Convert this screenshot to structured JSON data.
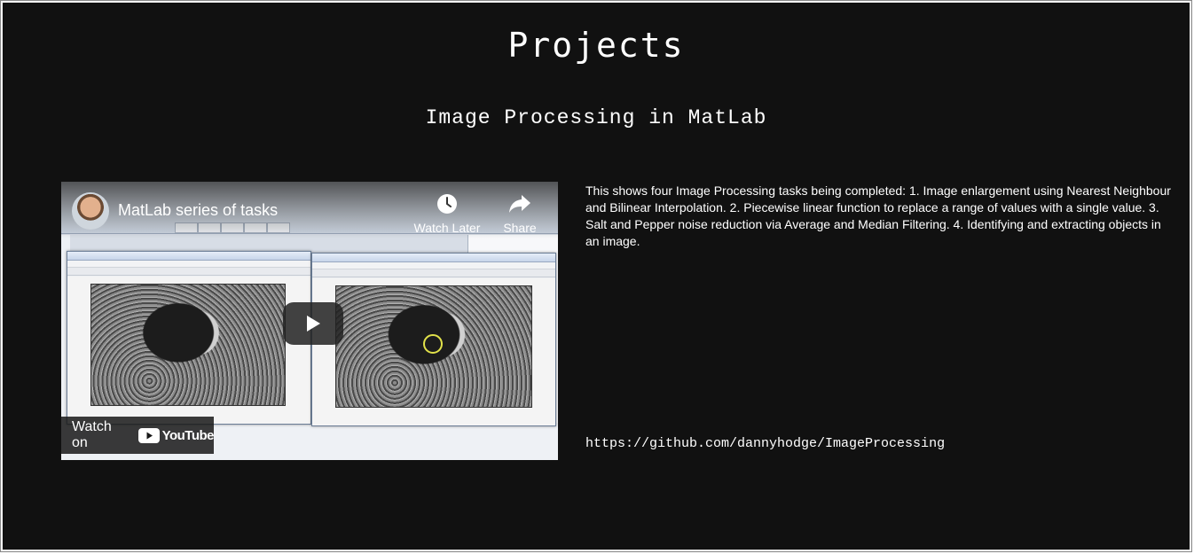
{
  "page": {
    "title": "Projects",
    "project_title": "Image Processing in MatLab"
  },
  "video": {
    "title": "MatLab series of tasks",
    "watch_later_label": "Watch Later",
    "share_label": "Share",
    "watch_on_label": "Watch on",
    "youtube_label": "YouTube",
    "icons": [
      "clock-icon",
      "share-arrow-icon",
      "play-icon",
      "youtube-logo-icon"
    ]
  },
  "description": "This shows four Image Processing tasks being completed: 1. Image enlargement using Nearest Neighbour and Bilinear Interpolation. 2. Piecewise linear function to replace a range of values with a single value. 3. Salt and Pepper noise reduction via Average and Median Filtering. 4. Identifying and extracting objects in an image.",
  "repo_link": "https://github.com/dannyhodge/ImageProcessing",
  "colors": {
    "background": "#111111",
    "text": "#ffffff",
    "play_button": "#212121",
    "youtube_red": "#ff0000"
  }
}
